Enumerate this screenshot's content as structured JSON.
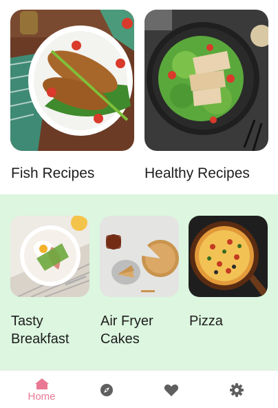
{
  "categories_top": [
    {
      "label": "Fish Recipes"
    },
    {
      "label": "Healthy Recipes"
    }
  ],
  "categories_bottom": [
    {
      "label": "Tasty Breakfast"
    },
    {
      "label": "Air Fryer Cakes"
    },
    {
      "label": "Pizza"
    }
  ],
  "bottom_nav": {
    "home_label": "Home",
    "items": [
      {
        "icon": "home-icon",
        "active": true
      },
      {
        "icon": "compass-icon",
        "active": false
      },
      {
        "icon": "heart-icon",
        "active": false
      },
      {
        "icon": "gear-icon",
        "active": false
      }
    ]
  },
  "colors": {
    "accent": "#e87894",
    "inactive_icon": "#5f5f5f",
    "section_background": "#dcf6df"
  }
}
